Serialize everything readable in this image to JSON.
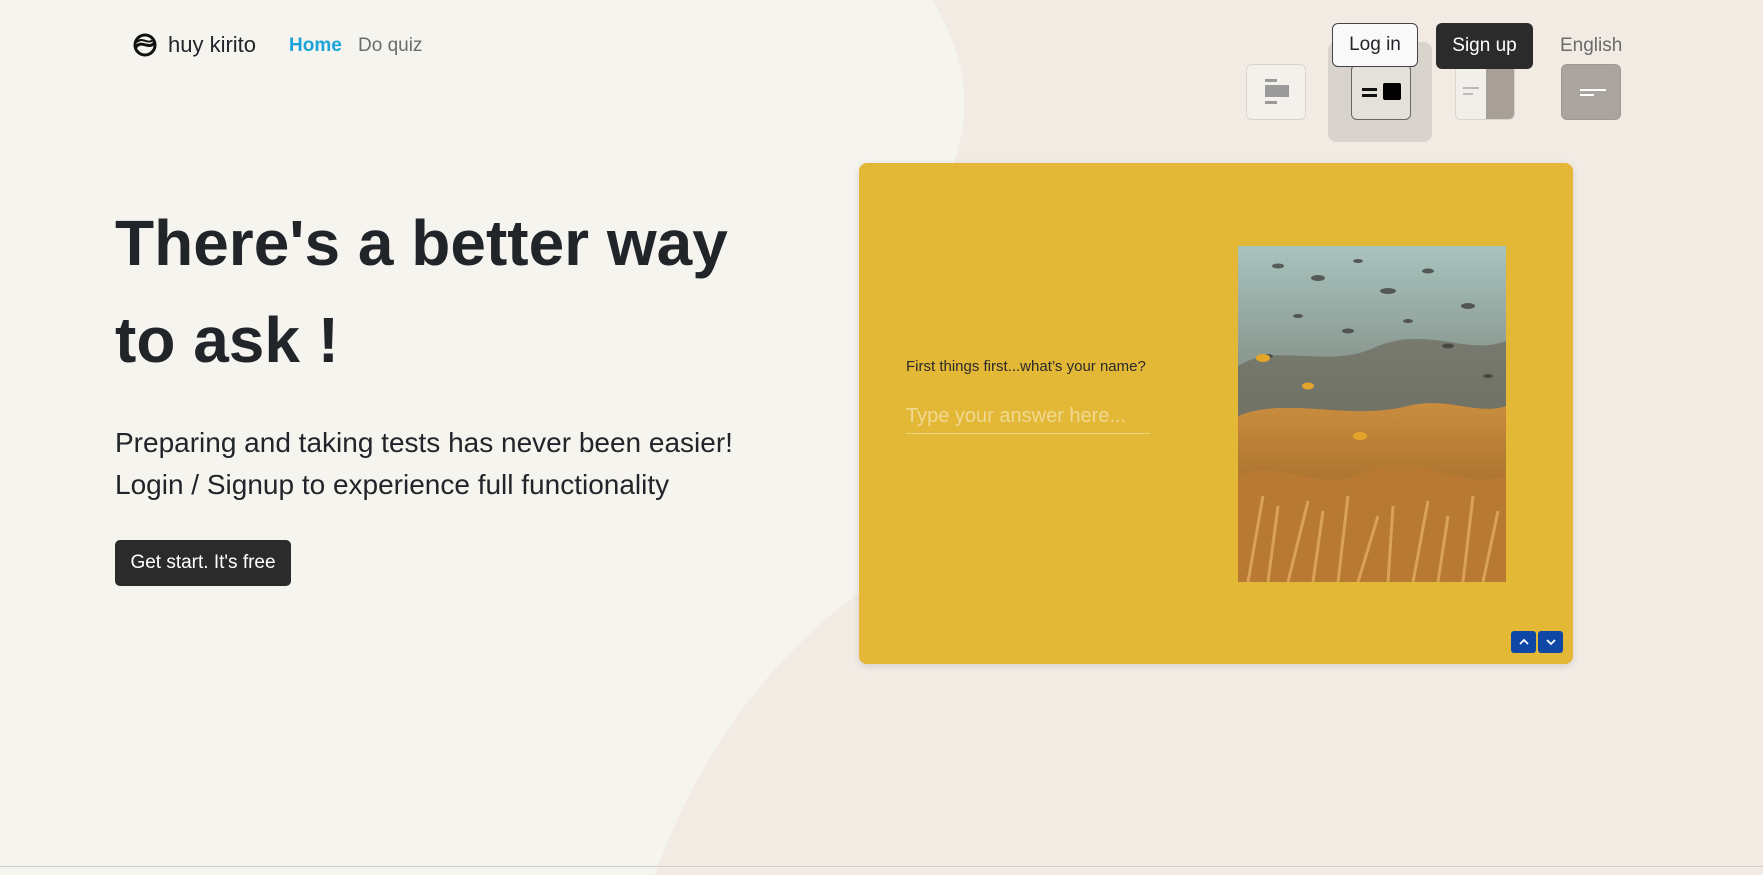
{
  "nav": {
    "brand": "huy kirito",
    "home": "Home",
    "do_quiz": "Do quiz",
    "login": "Log in",
    "signup": "Sign up",
    "language": "English"
  },
  "hero": {
    "title_line1": "There's a better way",
    "title_line2": "to ask !",
    "subtitle_line1": "Preparing and taking tests has never been easier!",
    "subtitle_line2": "Login / Signup to experience full functionality",
    "cta": "Get start. It's free"
  },
  "preview": {
    "question": "First things first...what’s your name?",
    "placeholder": "Type your answer here...",
    "background_color": "#e3b837"
  },
  "icons": {
    "brand_logo": "swirl-logo-icon",
    "layout_options": [
      "layout-top-image-icon",
      "layout-right-image-icon",
      "layout-split-right-icon",
      "layout-full-background-icon"
    ],
    "arrows": [
      "chevron-up-icon",
      "chevron-down-icon"
    ]
  },
  "colors": {
    "page_background": "#f6f4ef",
    "accent_link": "#1aa3d9",
    "primary_button": "#2b2b2b",
    "arrow_button": "#0e47a6"
  }
}
